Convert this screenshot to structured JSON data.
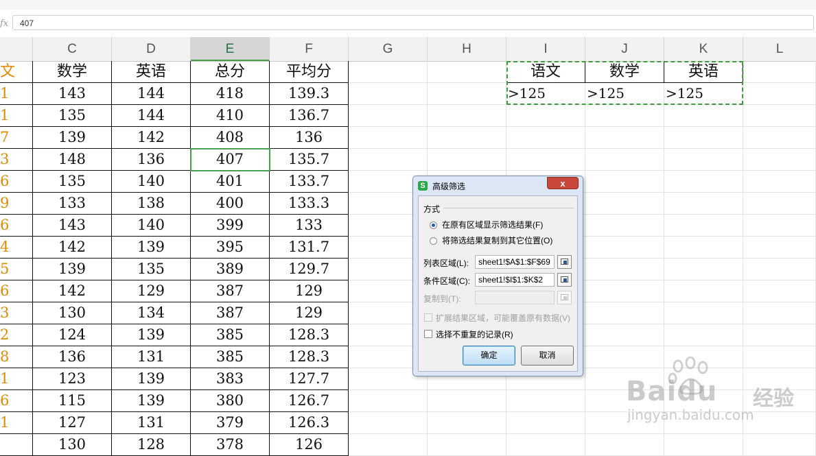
{
  "formula_bar": {
    "fx": "fx",
    "value": "407"
  },
  "columns": [
    "C",
    "D",
    "E",
    "F",
    "G",
    "H",
    "I",
    "J",
    "K",
    "L"
  ],
  "selected_column": "E",
  "table": {
    "first_col_partial_header": "文",
    "headers": [
      "数学",
      "英语",
      "总分",
      "平均分"
    ],
    "first_col_partial": [
      "1",
      "1",
      "7",
      "3",
      "6",
      "9",
      "6",
      "4",
      "5",
      "6",
      "3",
      "2",
      "8",
      "1",
      "6",
      "1",
      ""
    ],
    "rows": [
      [
        "143",
        "144",
        "418",
        "139.3"
      ],
      [
        "135",
        "144",
        "410",
        "136.7"
      ],
      [
        "139",
        "142",
        "408",
        "136"
      ],
      [
        "148",
        "136",
        "407",
        "135.7"
      ],
      [
        "135",
        "140",
        "401",
        "133.7"
      ],
      [
        "133",
        "138",
        "400",
        "133.3"
      ],
      [
        "143",
        "140",
        "399",
        "133"
      ],
      [
        "142",
        "139",
        "395",
        "131.7"
      ],
      [
        "139",
        "135",
        "389",
        "129.7"
      ],
      [
        "142",
        "129",
        "387",
        "129"
      ],
      [
        "130",
        "134",
        "387",
        "129"
      ],
      [
        "124",
        "139",
        "385",
        "128.3"
      ],
      [
        "136",
        "131",
        "385",
        "128.3"
      ],
      [
        "123",
        "139",
        "383",
        "127.7"
      ],
      [
        "115",
        "139",
        "380",
        "126.7"
      ],
      [
        "127",
        "131",
        "379",
        "126.3"
      ],
      [
        "130",
        "128",
        "378",
        "126"
      ]
    ]
  },
  "criteria": {
    "headers": [
      "语文",
      "数学",
      "英语"
    ],
    "values": [
      ">125",
      ">125",
      ">125"
    ]
  },
  "dialog": {
    "title": "高级筛选",
    "close": "x",
    "group_label": "方式",
    "option_in_place": "在原有区域显示筛选结果(F)",
    "option_copy": "将筛选结果复制到其它位置(O)",
    "list_range_label": "列表区域(L):",
    "list_range_value": "sheet1!$A$1:$F$69",
    "criteria_range_label": "条件区域(C):",
    "criteria_range_value": "sheet1!$I$1:$K$2",
    "copy_to_label": "复制到(T):",
    "copy_to_value": "",
    "expand_label": "扩展结果区域，可能覆盖原有数据(V)",
    "unique_label": "选择不重复的记录(R)",
    "ok": "确定",
    "cancel": "取消"
  },
  "watermark": {
    "brand": "Baidu",
    "cn": "经验",
    "url": "jingyan.baidu.com"
  }
}
